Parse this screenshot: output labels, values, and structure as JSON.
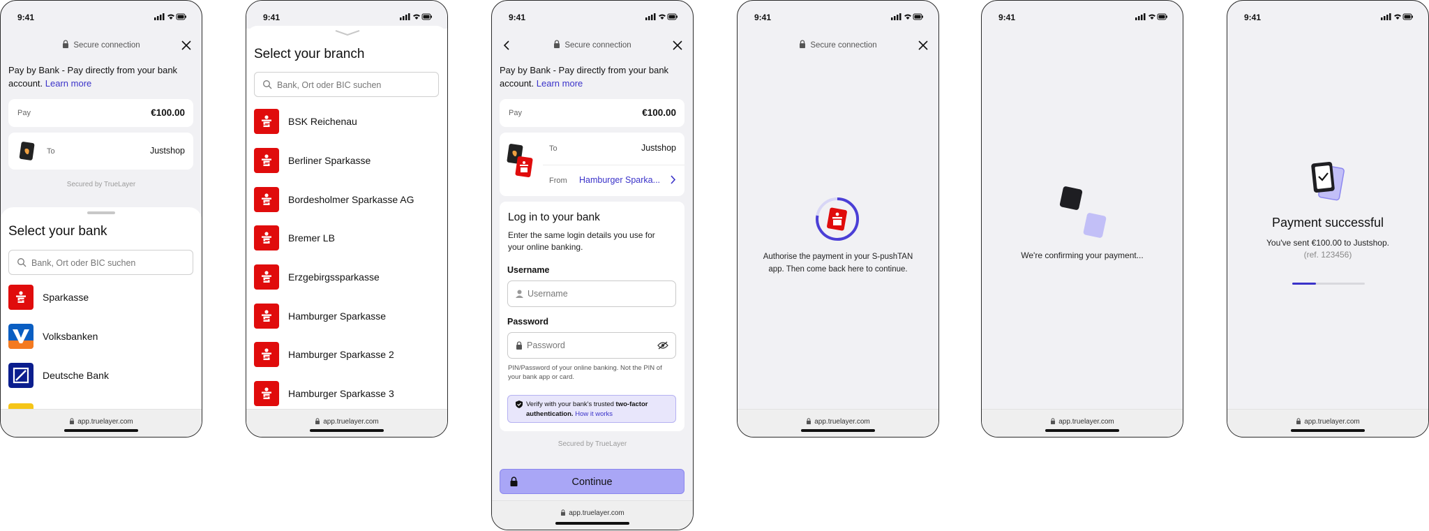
{
  "status_time": "9:41",
  "header": {
    "secure": "Secure connection"
  },
  "url": "app.truelayer.com",
  "secured_by": "Secured by TrueLayer",
  "pay_intro": {
    "text": "Pay by Bank - Pay directly from your bank account.",
    "link": "Learn more"
  },
  "pay": {
    "label": "Pay",
    "amount": "€100.00"
  },
  "to": {
    "label": "To",
    "merchant": "Justshop"
  },
  "from": {
    "label": "From",
    "bank": "Hamburger Sparka..."
  },
  "search_placeholder": "Bank, Ort oder BIC suchen",
  "screen1": {
    "sheet_title": "Select your bank",
    "banks": [
      {
        "name": "Sparkasse",
        "icon": "sparkasse-icon"
      },
      {
        "name": "Volksbanken",
        "icon": "volksbanken-icon"
      },
      {
        "name": "Deutsche Bank",
        "icon": "deutsche-bank-icon"
      }
    ]
  },
  "screen2": {
    "title": "Select your branch",
    "branches": [
      "BSK Reichenau",
      "Berliner Sparkasse",
      "Bordesholmer Sparkasse AG",
      "Bremer LB",
      "Erzgebirgssparkasse",
      "Hamburger Sparkasse",
      "Hamburger Sparkasse 2",
      "Hamburger Sparkasse 3"
    ]
  },
  "screen3": {
    "login_title": "Log in to your bank",
    "login_desc": "Enter the same login details you use for your online banking.",
    "username_label": "Username",
    "username_placeholder": "Username",
    "password_label": "Password",
    "password_placeholder": "Password",
    "pin_hint": "PIN/Password of your online banking. Not the PIN of your bank app or card.",
    "verify_prefix": "Verify with your bank's trusted ",
    "verify_bold": "two-factor authentication.",
    "verify_link": "How it works",
    "continue": "Continue"
  },
  "screen4": {
    "message": "Authorise the payment in your S-pushTAN app. Then come back here to continue."
  },
  "screen5": {
    "message": "We're confirming your payment..."
  },
  "screen6": {
    "title": "Payment successful",
    "line1": "You've sent €100.00 to Justshop.",
    "ref": "(ref. 123456)",
    "progress": 0.33
  },
  "colors": {
    "accent": "#3a32c9",
    "sparkasse_red": "#e00c0c",
    "button": "#a9a6f6",
    "background": "#f1f1f4"
  }
}
